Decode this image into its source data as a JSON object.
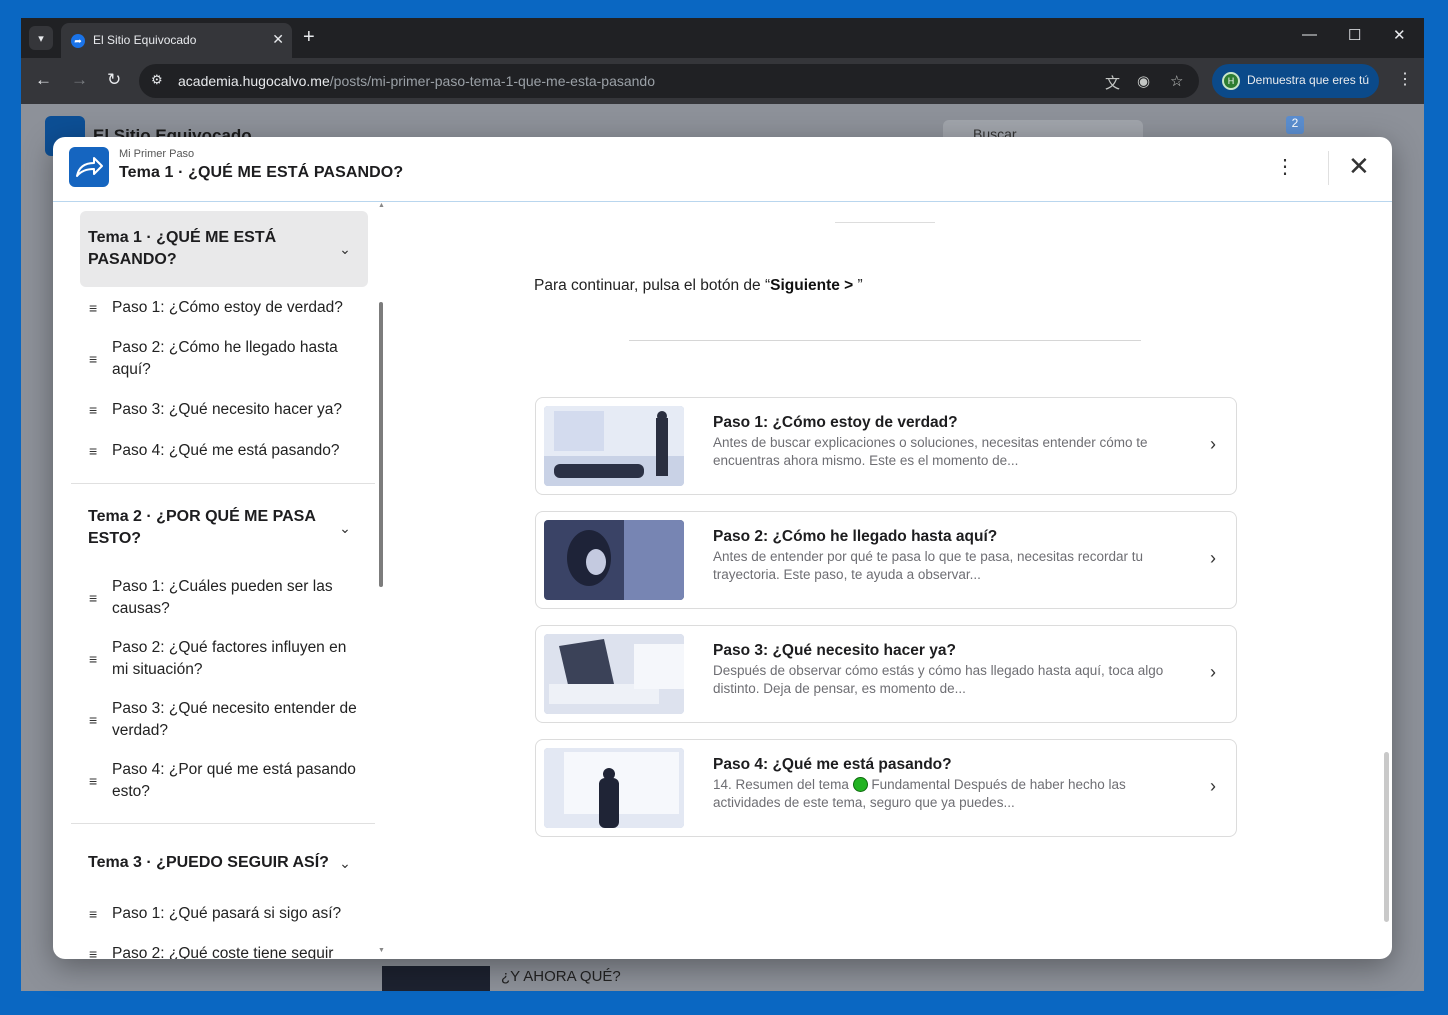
{
  "browser": {
    "tab_title": "El Sitio Equivocado",
    "new_tab": "+",
    "url_host": "academia.hugocalvo.me",
    "url_path": "/posts/mi-primer-paso-tema-1-que-me-esta-pasando",
    "profile_label": "Demuestra que eres tú",
    "profile_initial": "H"
  },
  "background_page": {
    "site_title": "El Sitio Equivocado",
    "search_placeholder": "Buscar",
    "notification_count": "2",
    "footer_text": "¿Y AHORA QUÉ?"
  },
  "modal": {
    "subtitle": "Mi Primer Paso",
    "title": "Tema 1 · ¿QUÉ ME ESTÁ PASANDO?"
  },
  "sidebar": {
    "topics": [
      {
        "label": "Tema 1 · ¿QUÉ ME ESTÁ PASANDO?",
        "steps": [
          "Paso 1: ¿Cómo estoy de verdad?",
          "Paso 2: ¿Cómo he llegado hasta aquí?",
          "Paso 3: ¿Qué necesito hacer ya?",
          "Paso 4: ¿Qué me está pasando?"
        ]
      },
      {
        "label": "Tema 2 · ¿POR QUÉ ME PASA ESTO?",
        "steps": [
          "Paso 1: ¿Cuáles pueden ser las causas?",
          "Paso 2: ¿Qué factores influyen en mi situación?",
          "Paso 3: ¿Qué necesito entender de verdad?",
          "Paso 4: ¿Por qué me está pasando esto?"
        ]
      },
      {
        "label": "Tema 3 · ¿PUEDO SEGUIR ASÍ?",
        "steps": [
          "Paso 1: ¿Qué pasará si sigo así?",
          "Paso 2: ¿Qué coste tiene seguir"
        ]
      }
    ]
  },
  "main": {
    "cta_prefix": "Para continuar, pulsa el botón de “",
    "cta_bold": "Siguiente > ",
    "cta_suffix": "”",
    "cards": [
      {
        "title": "Paso 1: ¿Cómo estoy de verdad?",
        "desc": "Antes de buscar explicaciones o soluciones, necesitas entender cómo te encuentras ahora mismo. Este es el momento de..."
      },
      {
        "title": "Paso 2: ¿Cómo he llegado hasta aquí?",
        "desc": "Antes de entender por qué te pasa lo que te pasa, necesitas recordar tu trayectoria. Este paso, te ayuda a observar..."
      },
      {
        "title": "Paso 3: ¿Qué necesito hacer ya?",
        "desc": "Después de observar cómo estás y cómo has llegado hasta aquí, toca algo distinto. Deja de pensar, es momento de..."
      },
      {
        "title": "Paso 4: ¿Qué me está pasando?",
        "desc_before": "14. Resumen del tema",
        "desc_after": "Fundamental Después de haber hecho las actividades de este tema, seguro que ya puedes..."
      }
    ]
  },
  "colors": {
    "accent": "#1565c0",
    "frame": "#0a67c2",
    "status_green": "#22b322"
  }
}
